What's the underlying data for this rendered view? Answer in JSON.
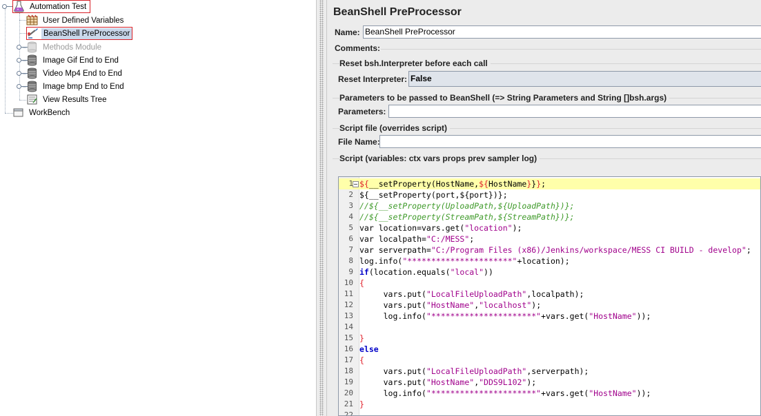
{
  "tree": {
    "root": {
      "label": "Automation Test",
      "icon": "flask-icon"
    },
    "items": [
      {
        "label": "User Defined Variables",
        "icon": "variables-icon"
      },
      {
        "label": "BeanShell PreProcessor",
        "icon": "preprocessor-icon"
      },
      {
        "label": "Methods Module",
        "icon": "thread-group-icon"
      },
      {
        "label": "Image Gif End to End",
        "icon": "thread-group-icon"
      },
      {
        "label": "Video Mp4 End to End",
        "icon": "thread-group-icon"
      },
      {
        "label": "Image bmp End to End",
        "icon": "thread-group-icon"
      },
      {
        "label": "View Results Tree",
        "icon": "listener-icon"
      }
    ],
    "workbench": {
      "label": "WorkBench",
      "icon": "workbench-icon"
    }
  },
  "panel": {
    "title": "BeanShell PreProcessor",
    "name_label": "Name:",
    "name_value": "BeanShell PreProcessor",
    "comments_label": "Comments:",
    "reset_group": "Reset bsh.Interpreter before each call",
    "reset_label": "Reset Interpreter:",
    "reset_value": "False",
    "params_group": "Parameters to be passed to BeanShell (=> String Parameters and String []bsh.args)",
    "params_label": "Parameters:",
    "params_value": "",
    "file_group": "Script file (overrides script)",
    "file_label": "File Name:",
    "file_value": "",
    "script_group": "Script (variables: ctx vars props prev sampler log)"
  },
  "script": {
    "lines": [
      {
        "n": "1",
        "fold": true,
        "current": true,
        "tokens": [
          [
            "br",
            "${"
          ],
          [
            "",
            "__setProperty(HostName,"
          ],
          [
            "br",
            "${"
          ],
          [
            "",
            "HostName"
          ],
          [
            "br",
            "}"
          ],
          [
            "",
            "}"
          ],
          [
            "br",
            "}"
          ],
          [
            "",
            ";"
          ]
        ]
      },
      {
        "n": "2",
        "tokens": [
          [
            "",
            "${__setProperty(port,${port})};"
          ]
        ]
      },
      {
        "n": "3",
        "tokens": [
          [
            "cmt",
            "//${__setProperty(UploadPath,${UploadPath})};"
          ]
        ]
      },
      {
        "n": "4",
        "tokens": [
          [
            "cmt",
            "//${__setProperty(StreamPath,${StreamPath})};"
          ]
        ]
      },
      {
        "n": "5",
        "tokens": [
          [
            "",
            "var location=vars.get("
          ],
          [
            "str",
            "\"location\""
          ],
          [
            "",
            ");"
          ]
        ]
      },
      {
        "n": "6",
        "tokens": [
          [
            "",
            "var localpath="
          ],
          [
            "str",
            "\"C:/MESS\""
          ],
          [
            "",
            ";"
          ]
        ]
      },
      {
        "n": "7",
        "tokens": [
          [
            "",
            "var serverpath="
          ],
          [
            "str",
            "\"C:/Program Files (x86)/Jenkins/workspace/MESS CI BUILD - develop\""
          ],
          [
            "",
            ";"
          ]
        ]
      },
      {
        "n": "8",
        "tokens": [
          [
            "",
            "log.info("
          ],
          [
            "str",
            "\"**********************\""
          ],
          [
            "",
            "+location);"
          ]
        ]
      },
      {
        "n": "9",
        "tokens": [
          [
            "kw",
            "if"
          ],
          [
            "",
            "(location.equals("
          ],
          [
            "str",
            "\"local\""
          ],
          [
            "",
            "))"
          ]
        ]
      },
      {
        "n": "10",
        "tokens": [
          [
            "br",
            "{"
          ]
        ]
      },
      {
        "n": "11",
        "tokens": [
          [
            "",
            "     vars.put("
          ],
          [
            "str",
            "\"LocalFileUploadPath\""
          ],
          [
            "",
            ",localpath);"
          ]
        ]
      },
      {
        "n": "12",
        "tokens": [
          [
            "",
            "     vars.put("
          ],
          [
            "str",
            "\"HostName\""
          ],
          [
            "",
            ","
          ],
          [
            "str",
            "\"localhost\""
          ],
          [
            "",
            ");"
          ]
        ]
      },
      {
        "n": "13",
        "tokens": [
          [
            "",
            "     log.info("
          ],
          [
            "str",
            "\"**********************\""
          ],
          [
            "",
            "+vars.get("
          ],
          [
            "str",
            "\"HostName\""
          ],
          [
            "",
            "));"
          ]
        ]
      },
      {
        "n": "14",
        "tokens": []
      },
      {
        "n": "15",
        "tokens": [
          [
            "br",
            "}"
          ]
        ]
      },
      {
        "n": "16",
        "tokens": [
          [
            "kw",
            "else"
          ]
        ]
      },
      {
        "n": "17",
        "tokens": [
          [
            "br",
            "{"
          ]
        ]
      },
      {
        "n": "18",
        "tokens": [
          [
            "",
            "     vars.put("
          ],
          [
            "str",
            "\"LocalFileUploadPath\""
          ],
          [
            "",
            ",serverpath);"
          ]
        ]
      },
      {
        "n": "19",
        "tokens": [
          [
            "",
            "     vars.put("
          ],
          [
            "str",
            "\"HostName\""
          ],
          [
            "",
            ","
          ],
          [
            "str",
            "\"DDS9L102\""
          ],
          [
            "",
            ");"
          ]
        ]
      },
      {
        "n": "20",
        "tokens": [
          [
            "",
            "     log.info("
          ],
          [
            "str",
            "\"**********************\""
          ],
          [
            "",
            "+vars.get("
          ],
          [
            "str",
            "\"HostName\""
          ],
          [
            "",
            "));"
          ]
        ]
      },
      {
        "n": "21",
        "tokens": [
          [
            "br",
            "}"
          ]
        ]
      },
      {
        "n": "22",
        "tokens": []
      }
    ]
  },
  "colors": {
    "selection": "#c9d7ea",
    "highlight_box": "#d81f26",
    "current_line": "#ffffaa",
    "string": "#a0008b",
    "comment": "#3f9a2a",
    "keyword": "#0000c8"
  }
}
